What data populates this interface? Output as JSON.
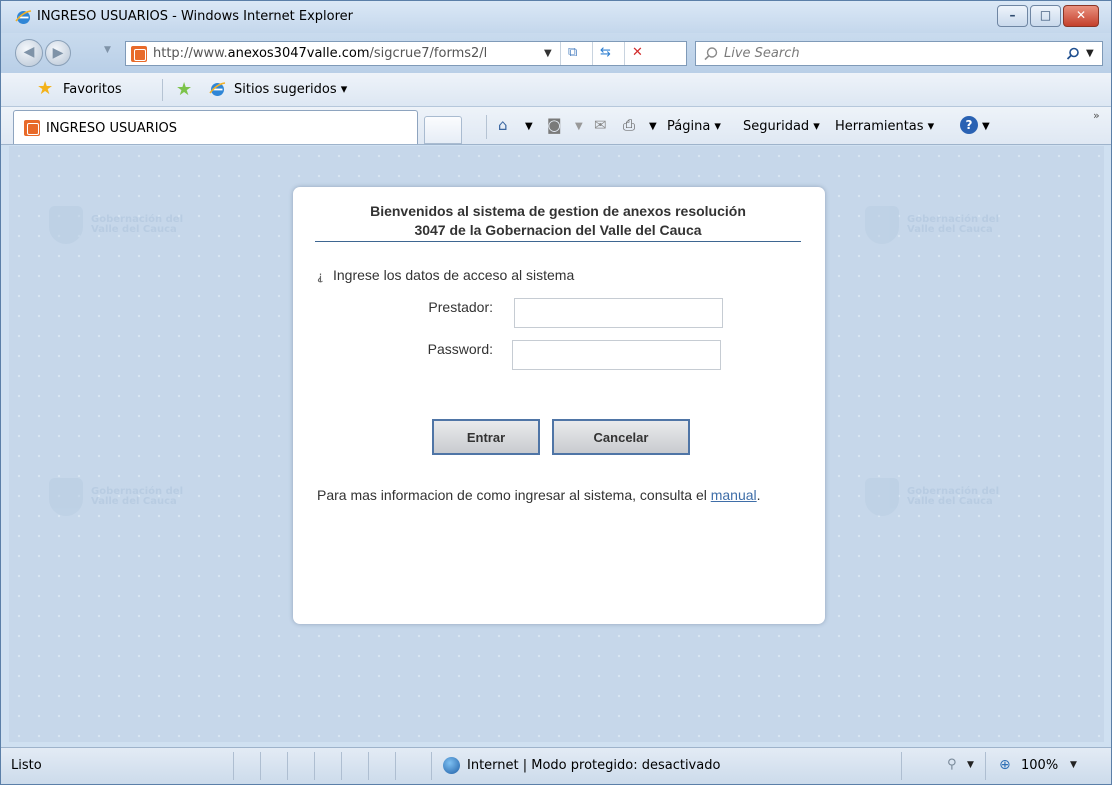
{
  "window": {
    "title": "INGRESO USUARIOS - Windows Internet Explorer",
    "minimize_glyph": "–",
    "maximize_glyph": "□",
    "close_glyph": "✕"
  },
  "address_bar": {
    "url_prefix": "http://www.",
    "url_host": "anexos3047valle.com",
    "url_path": "/sigcrue7/forms2/l",
    "search_placeholder": "Live Search"
  },
  "favorites_bar": {
    "favorites_label": "Favoritos",
    "suggested_sites_label": "Sitios sugeridos ▾"
  },
  "tab": {
    "label": "INGRESO USUARIOS"
  },
  "command_bar": {
    "page_label": "Página ▾",
    "security_label": "Seguridad ▾",
    "tools_label": "Herramientas ▾"
  },
  "login": {
    "header_line1": "Bienvenidos al sistema de gestion de anexos resolución",
    "header_line2": "3047 de la Gobernacion del Valle del Cauca",
    "lead_text": "Ingrese los datos de acceso al sistema",
    "prestador_label": "Prestador:",
    "prestador_value": "",
    "password_label": "Password:",
    "password_value": "",
    "enter_button": "Entrar",
    "cancel_button": "Cancelar",
    "info_text": "Para mas informacion de como ingresar al sistema, consulta el",
    "manual_link": "manual",
    "info_suffix": "."
  },
  "watermark": {
    "line1": "Gobernación del",
    "line2": "Valle del Cauca"
  },
  "status_bar": {
    "status_text": "Listo",
    "zone_text": "Internet | Modo protegido: desactivado",
    "zoom_text": "100%"
  },
  "colors": {
    "accent": "#3e6691",
    "button_border": "#4f75a6",
    "link": "#3f6ea8",
    "page_background": "#c6d7ea"
  }
}
